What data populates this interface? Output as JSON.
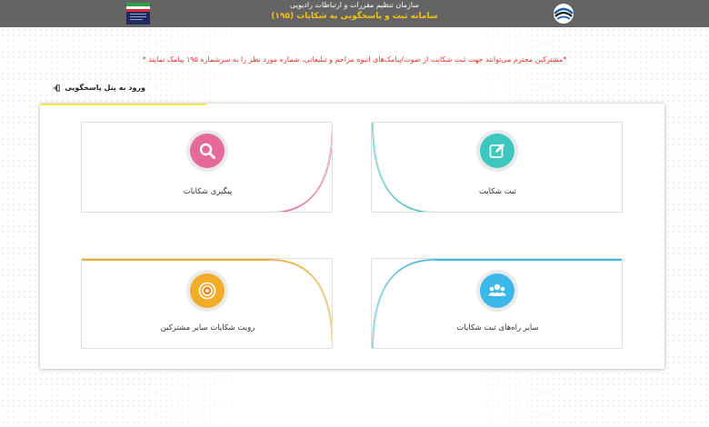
{
  "header": {
    "org_name": "سازمان تنظیم مقررات و ارتباطات رادیویی",
    "system_name": "سامانه ثبت و پاسخگویی به شکایات (۱۹۵)"
  },
  "notice": "*مشترکین محترم می‌توانند جهت ثبت شکایت از صوت/پیامک‌های انبوه مزاحم و تبلیغاتی، شماره مورد نظر را به سرشماره ۱۹۵ پیامک نمایند *",
  "login": {
    "label": "ورود به پنل پاسخگویی"
  },
  "cards": [
    {
      "label": "ثبت شکایت",
      "icon": "edit-icon",
      "color": "#3cc8c0"
    },
    {
      "label": "پیگیری شکایات",
      "icon": "search-icon",
      "color": "#e56a9a"
    },
    {
      "label": "سایر راه‌های ثبت شکایات",
      "icon": "users-icon",
      "color": "#3bb8e8"
    },
    {
      "label": "رویت شکایات سایر مشترکین",
      "icon": "target-icon",
      "color": "#f2ad28"
    }
  ],
  "colors": {
    "topbar": "#646464",
    "header_title": "#f1c40f",
    "notice": "#e6332a",
    "accent_line": "#f4e64d"
  }
}
